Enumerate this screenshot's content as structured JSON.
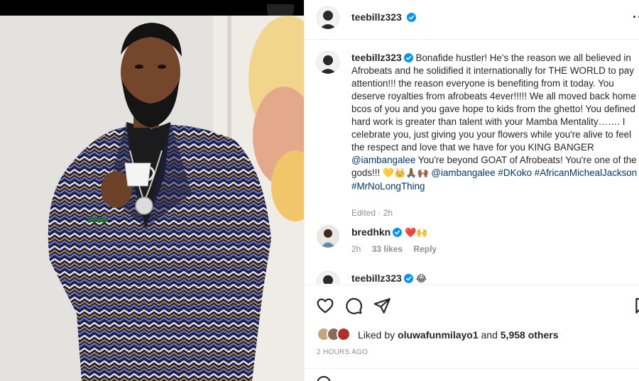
{
  "post": {
    "author": "teebillz323",
    "more_icon": "more-horizontal-icon"
  },
  "caption": {
    "author": "teebillz323",
    "text_1": " Bonafide hustler! He's the reason we all believed in Afrobeats and he solidified it internationally for THE WORLD to pay attention!!! the reason everyone is benefiting from it today. You deserve royalties from afrobeats 4ever!!!!! We all moved back home bcos of you and you gave hope to kids from the ghetto! You defined hard work is greater than talent with your Mamba Mentality……. I celebrate you, just giving you your flowers while you're alive to feel the respect and love that we have for you KING BANGER ",
    "mention_1": "@iambangalee",
    "text_2": " You're beyond GOAT of Afrobeats! You're one of the gods!!! ",
    "emojis": "💛👑🙏🏾🙌🏾",
    "mention_2": "@iambangalee",
    "hashtag_1": "#DKoko",
    "hashtag_2": "#AfricanMichealJackson",
    "hashtag_3": "#MrNoLongThing",
    "edited": "Edited · 2h"
  },
  "comments": [
    {
      "author": "bredhkn",
      "text": "❤️🙌",
      "time": "2h",
      "likes": "33 likes",
      "reply": "Reply"
    },
    {
      "author": "teebillz323",
      "text": "😂"
    }
  ],
  "actions": {
    "like_icon": "heart-icon",
    "comment_icon": "comment-bubble-icon",
    "share_icon": "paper-plane-icon",
    "save_icon": "bookmark-icon"
  },
  "likes": {
    "prefix": "Liked by ",
    "user": "oluwafunmilayo1",
    "joiner": " and ",
    "others": "5,958 others"
  },
  "timestamp": "2 HOURS AGO",
  "colors": {
    "verified": "#0095f6",
    "link": "#00376b",
    "muted": "#8e8e8e",
    "border": "#efefef"
  }
}
